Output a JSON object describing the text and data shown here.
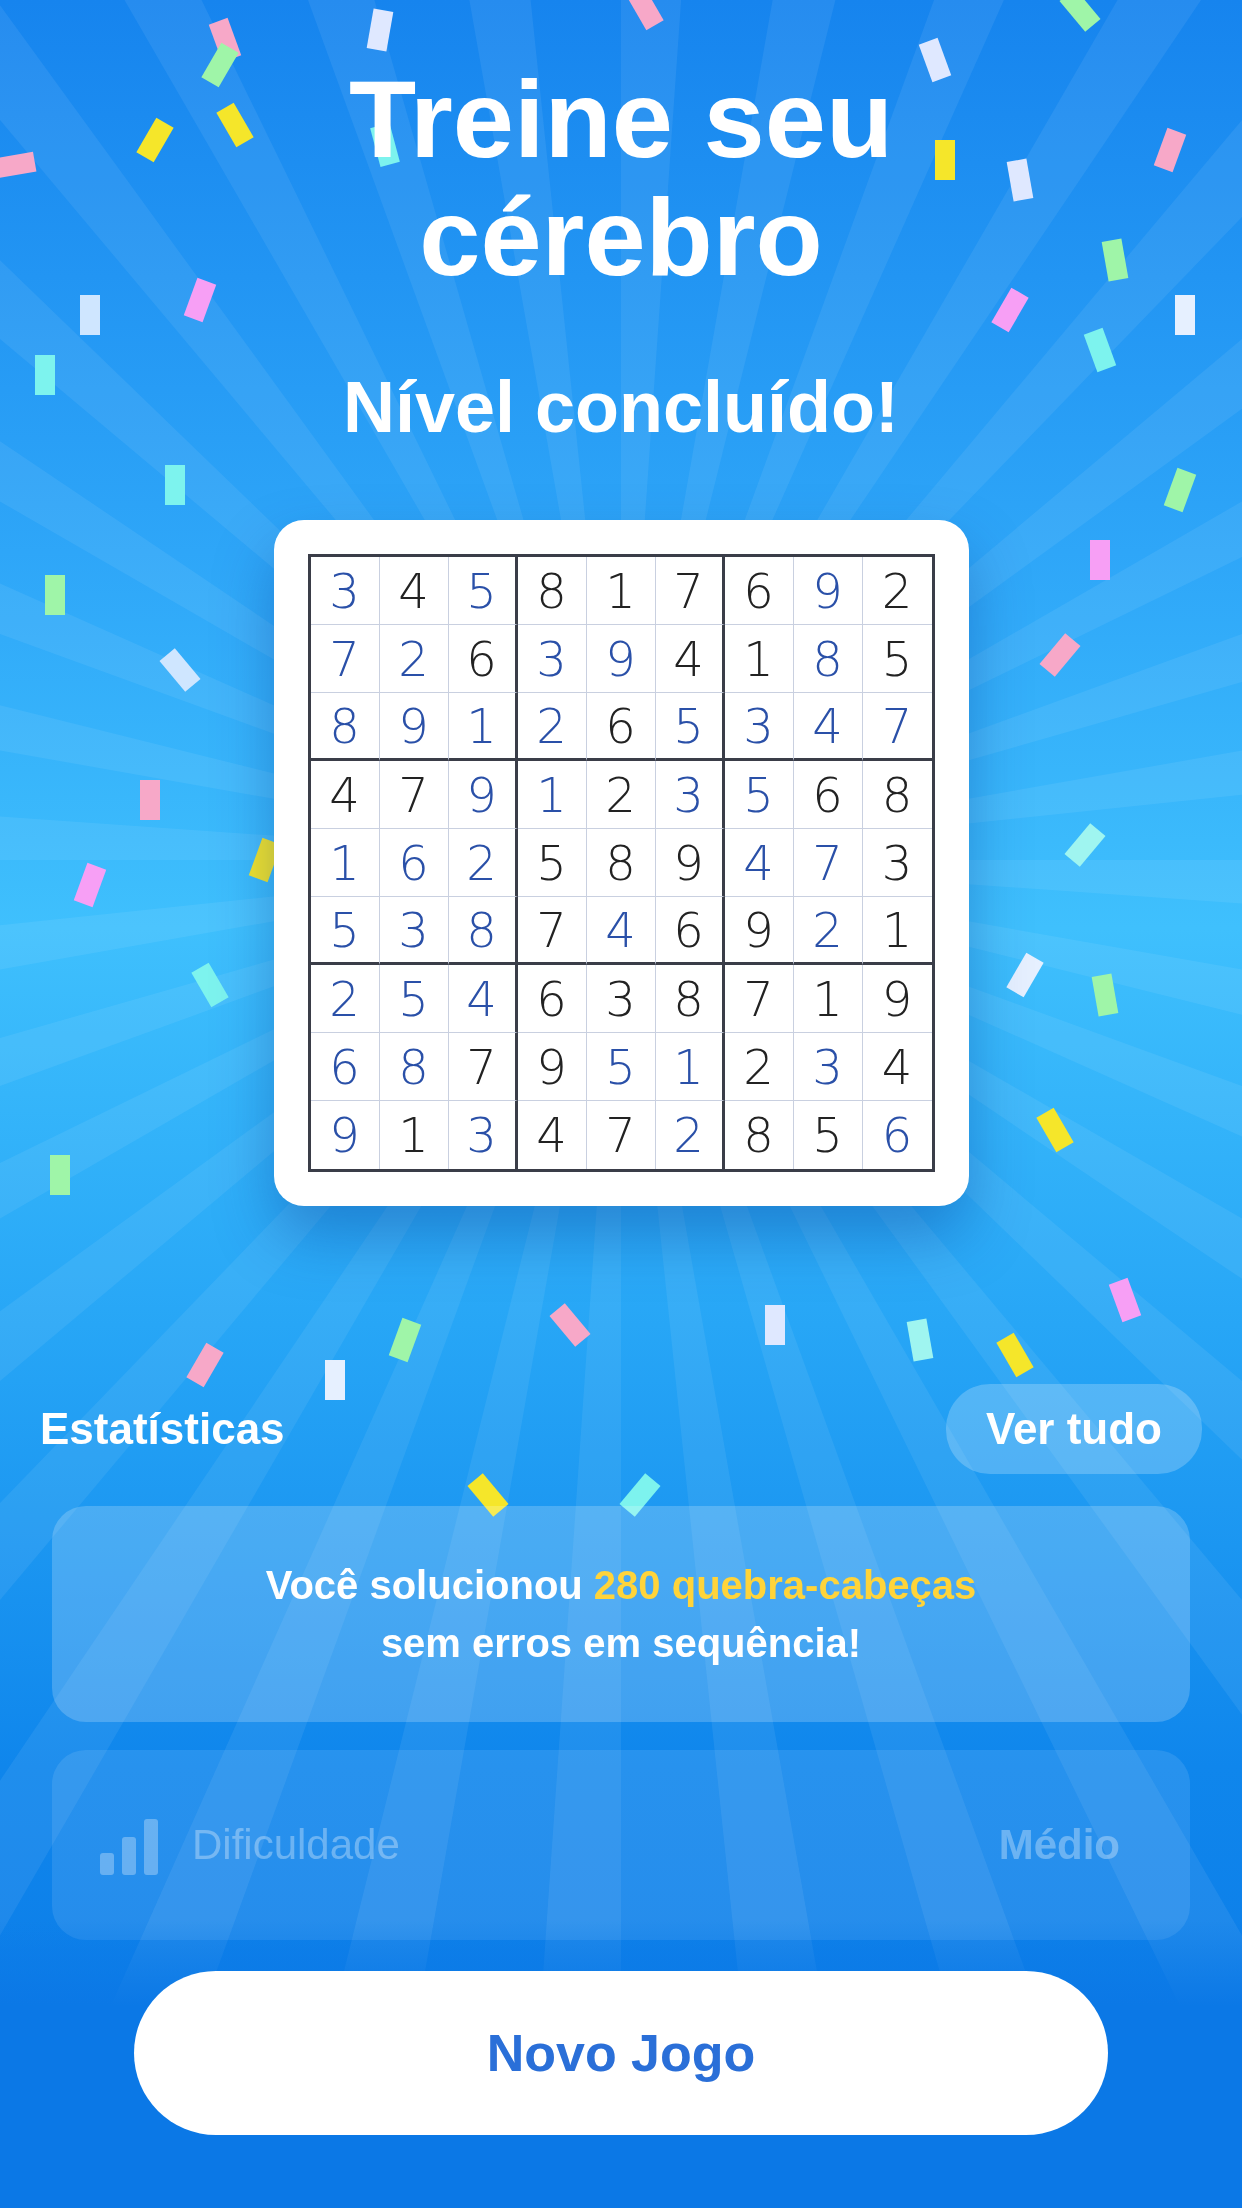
{
  "title": "Treine seu cérebro",
  "subtitle": "Nível concluído!",
  "board": {
    "rows": [
      [
        {
          "digit": "3",
          "given": false
        },
        {
          "digit": "4",
          "given": true
        },
        {
          "digit": "5",
          "given": false
        },
        {
          "digit": "8",
          "given": true
        },
        {
          "digit": "1",
          "given": true
        },
        {
          "digit": "7",
          "given": true
        },
        {
          "digit": "6",
          "given": true
        },
        {
          "digit": "9",
          "given": false
        },
        {
          "digit": "2",
          "given": true
        }
      ],
      [
        {
          "digit": "7",
          "given": false
        },
        {
          "digit": "2",
          "given": false
        },
        {
          "digit": "6",
          "given": true
        },
        {
          "digit": "3",
          "given": false
        },
        {
          "digit": "9",
          "given": false
        },
        {
          "digit": "4",
          "given": true
        },
        {
          "digit": "1",
          "given": true
        },
        {
          "digit": "8",
          "given": false
        },
        {
          "digit": "5",
          "given": true
        }
      ],
      [
        {
          "digit": "8",
          "given": false
        },
        {
          "digit": "9",
          "given": false
        },
        {
          "digit": "1",
          "given": false
        },
        {
          "digit": "2",
          "given": false
        },
        {
          "digit": "6",
          "given": true
        },
        {
          "digit": "5",
          "given": false
        },
        {
          "digit": "3",
          "given": false
        },
        {
          "digit": "4",
          "given": false
        },
        {
          "digit": "7",
          "given": false
        }
      ],
      [
        {
          "digit": "4",
          "given": true
        },
        {
          "digit": "7",
          "given": true
        },
        {
          "digit": "9",
          "given": false
        },
        {
          "digit": "1",
          "given": false
        },
        {
          "digit": "2",
          "given": true
        },
        {
          "digit": "3",
          "given": false
        },
        {
          "digit": "5",
          "given": false
        },
        {
          "digit": "6",
          "given": true
        },
        {
          "digit": "8",
          "given": true
        }
      ],
      [
        {
          "digit": "1",
          "given": false
        },
        {
          "digit": "6",
          "given": false
        },
        {
          "digit": "2",
          "given": false
        },
        {
          "digit": "5",
          "given": true
        },
        {
          "digit": "8",
          "given": true
        },
        {
          "digit": "9",
          "given": true
        },
        {
          "digit": "4",
          "given": false
        },
        {
          "digit": "7",
          "given": false
        },
        {
          "digit": "3",
          "given": true
        }
      ],
      [
        {
          "digit": "5",
          "given": false
        },
        {
          "digit": "3",
          "given": false
        },
        {
          "digit": "8",
          "given": false
        },
        {
          "digit": "7",
          "given": true
        },
        {
          "digit": "4",
          "given": false
        },
        {
          "digit": "6",
          "given": true
        },
        {
          "digit": "9",
          "given": true
        },
        {
          "digit": "2",
          "given": false
        },
        {
          "digit": "1",
          "given": true
        }
      ],
      [
        {
          "digit": "2",
          "given": false
        },
        {
          "digit": "5",
          "given": false
        },
        {
          "digit": "4",
          "given": false
        },
        {
          "digit": "6",
          "given": true
        },
        {
          "digit": "3",
          "given": true
        },
        {
          "digit": "8",
          "given": true
        },
        {
          "digit": "7",
          "given": true
        },
        {
          "digit": "1",
          "given": true
        },
        {
          "digit": "9",
          "given": true
        }
      ],
      [
        {
          "digit": "6",
          "given": false
        },
        {
          "digit": "8",
          "given": false
        },
        {
          "digit": "7",
          "given": true
        },
        {
          "digit": "9",
          "given": true
        },
        {
          "digit": "5",
          "given": false
        },
        {
          "digit": "1",
          "given": false
        },
        {
          "digit": "2",
          "given": true
        },
        {
          "digit": "3",
          "given": false
        },
        {
          "digit": "4",
          "given": true
        }
      ],
      [
        {
          "digit": "9",
          "given": false
        },
        {
          "digit": "1",
          "given": true
        },
        {
          "digit": "3",
          "given": false
        },
        {
          "digit": "4",
          "given": true
        },
        {
          "digit": "7",
          "given": true
        },
        {
          "digit": "2",
          "given": false
        },
        {
          "digit": "8",
          "given": true
        },
        {
          "digit": "5",
          "given": true
        },
        {
          "digit": "6",
          "given": false
        }
      ]
    ]
  },
  "stats": {
    "label": "Estatísticas",
    "see_all": "Ver tudo",
    "message": "Você solucionou **280 quebra-cabeças**\nsem erros em sequência!",
    "rows": [
      {
        "label": "Dificuldade",
        "value": "Médio"
      }
    ]
  },
  "new_game": "Novo Jogo"
}
